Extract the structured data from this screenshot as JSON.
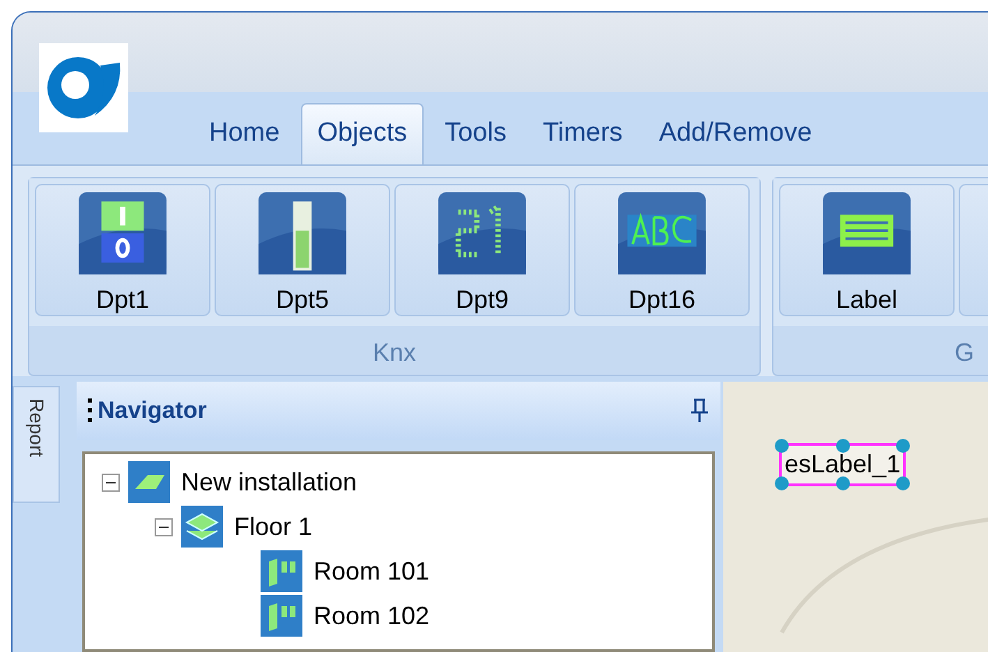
{
  "ribbon": {
    "tabs": [
      {
        "label": "Home",
        "selected": false
      },
      {
        "label": "Objects",
        "selected": true
      },
      {
        "label": "Tools",
        "selected": false
      },
      {
        "label": "Timers",
        "selected": false
      },
      {
        "label": "Add/Remove",
        "selected": false
      }
    ],
    "groups": [
      {
        "label": "Knx",
        "buttons": [
          {
            "label": "Dpt1",
            "kind": "switch"
          },
          {
            "label": "Dpt5",
            "kind": "bar"
          },
          {
            "label": "Dpt9",
            "kind": "digits"
          },
          {
            "label": "Dpt16",
            "kind": "text"
          }
        ]
      },
      {
        "label": "G",
        "buttons": [
          {
            "label": "Label",
            "kind": "label"
          },
          {
            "kind": "blank"
          }
        ]
      }
    ]
  },
  "side_tab": {
    "label": "Report"
  },
  "navigator": {
    "title": "Navigator",
    "tree": [
      {
        "label": "New installation",
        "kind": "installation",
        "expanded": true,
        "children": [
          {
            "label": "Floor 1",
            "kind": "floor",
            "expanded": true,
            "children": [
              {
                "label": "Room 101",
                "kind": "room"
              },
              {
                "label": "Room 102",
                "kind": "room"
              }
            ]
          }
        ]
      }
    ]
  },
  "canvas": {
    "element": {
      "label": "esLabel_1",
      "selected": true
    }
  }
}
